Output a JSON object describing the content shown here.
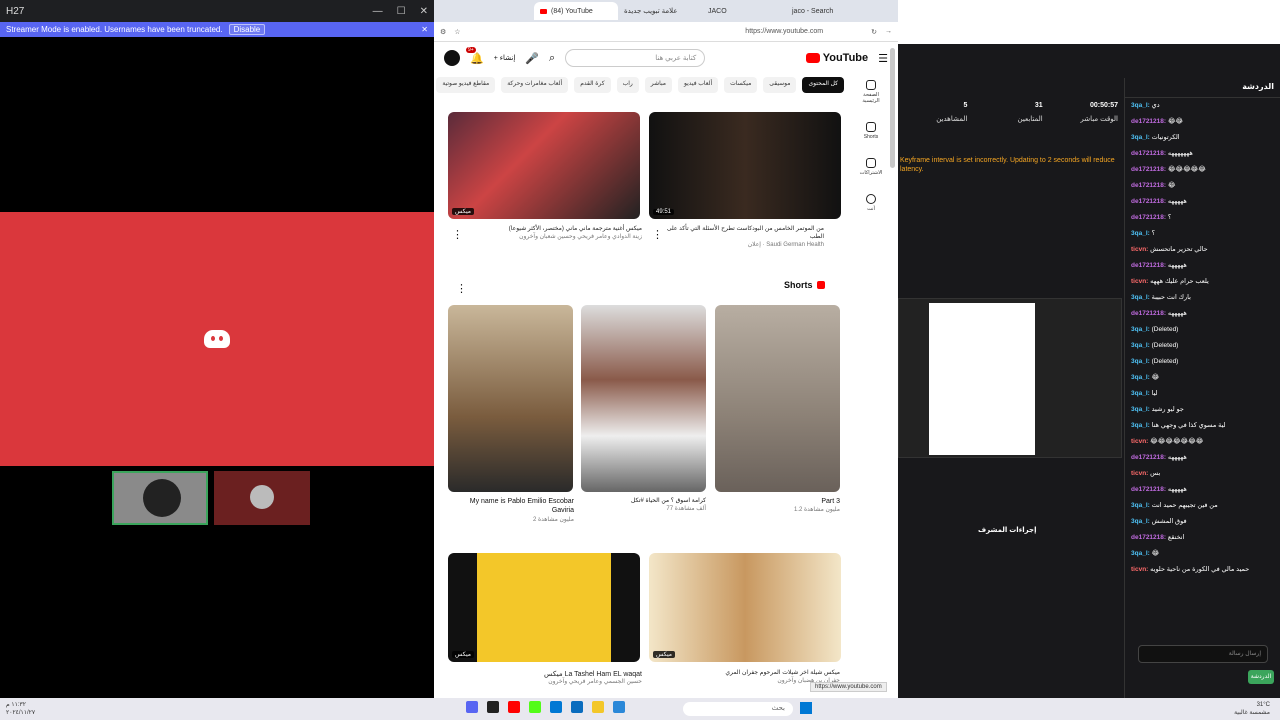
{
  "discord": {
    "title": "H27",
    "streamer_banner": "Streamer Mode is enabled. Usernames have been truncated.",
    "disable_label": "Disable"
  },
  "browser": {
    "tabs": [
      {
        "label": "(84) YouTube"
      },
      {
        "label": "علامة تبويب جديدة"
      },
      {
        "label": "JACO"
      },
      {
        "label": "jaco - Search"
      }
    ],
    "url": "https://www.youtube.com",
    "status_url": "https://www.youtube.com"
  },
  "youtube": {
    "logo": "YouTube",
    "search_placeholder": "كتابة عربي هنا",
    "notification_count": "9+",
    "create_label": "إنشاء",
    "chips": [
      "كل المحتوى",
      "موسيقى",
      "ميكسات",
      "ألعاب فيديو",
      "مباشر",
      "راب",
      "كرة القدم",
      "ألعاب مغامرات وحركة",
      "مقاطع فيديو صوتية"
    ],
    "sidebar": [
      {
        "label": "الصفحة الرئيسية"
      },
      {
        "label": "Shorts"
      },
      {
        "label": "الاشتراكات"
      },
      {
        "label": "أنت"
      }
    ],
    "videos": [
      {
        "title": "ميكس أغنية مترجمة ماني ماني (مختصر، الأكثر شيوعا)",
        "meta": "زينة الدوادي وعامر فريحي وحسين شعبان وآخرون",
        "duration": "ميكس"
      },
      {
        "title": "من الموتمر الخامس من البودكاست تطرح الأسئلة التي تأكد على الطب",
        "meta": "Saudi German Health · إعلان",
        "duration": "49:51"
      }
    ],
    "shorts_heading": "Shorts",
    "shorts": [
      {
        "title": "My name is Pablo Emilio Escobar Gaviria",
        "meta": "2 مليون مشاهدة"
      },
      {
        "title": "كرامة اسوق ؟ من الحياة #تكل",
        "meta": "77 ألف مشاهدة"
      },
      {
        "title": "Part 3",
        "meta": "1.2 مليون مشاهدة"
      }
    ],
    "videos2": [
      {
        "title": "La Tashel Ham EL waqat ميكس",
        "meta": "حسين الجسمي وعامر فريحي وآخرون",
        "duration": "ميكس"
      },
      {
        "title": "ميكس شيلة اخر شيلات المرحوم جفران المري",
        "meta": "جفران بن هضبان وآخرون",
        "duration": "ميكس"
      }
    ]
  },
  "obs": {
    "stats": [
      {
        "label": "الوقت مباشر",
        "value": "00:50:57"
      },
      {
        "label": "المتابعين",
        "value": "31"
      },
      {
        "label": "المشاهدين",
        "value": "5"
      }
    ],
    "warning": "Keyframe interval is set incorrectly. Updating to 2 seconds will reduce latency.",
    "docks": [
      "إجراءات المشرف"
    ],
    "chat_title": "الدردشة",
    "chat_input_placeholder": "إرسال رسالة",
    "chat_button": "الدردشة",
    "messages": [
      {
        "user": "3qa_l:",
        "text": "دي"
      },
      {
        "user": "de1721218:",
        "text": "😂😂"
      },
      {
        "user": "3qa_l:",
        "text": "الكرتونيات"
      },
      {
        "user": "de1721218:",
        "text": "هههههههه"
      },
      {
        "user": "de1721218:",
        "text": "😂😂😂😂😂"
      },
      {
        "user": "de1721218:",
        "text": "😂"
      },
      {
        "user": "de1721218:",
        "text": "هههههه"
      },
      {
        "user": "de1721218:",
        "text": "؟"
      },
      {
        "user": "3qa_l:",
        "text": "؟"
      },
      {
        "user": "ticvn:",
        "text": "حالي تحزير ماتحسش"
      },
      {
        "user": "de1721218:",
        "text": "هههههه"
      },
      {
        "user": "ticvn:",
        "text": "يلعب حرام عليك هههه"
      },
      {
        "user": "3qa_l:",
        "text": "بارك انت حبيبة"
      },
      {
        "user": "de1721218:",
        "text": "هههههه"
      },
      {
        "user": "3qa_l:",
        "text": "(Deleted)"
      },
      {
        "user": "3qa_l:",
        "text": "(Deleted)"
      },
      {
        "user": "3qa_l:",
        "text": "(Deleted)"
      },
      {
        "user": "3qa_l:",
        "text": "😂"
      },
      {
        "user": "3qa_l:",
        "text": "ليا"
      },
      {
        "user": "3qa_l:",
        "text": "جو ليو رشيد"
      },
      {
        "user": "3qa_l:",
        "text": "لية مسوي كذا في وجهي هنا"
      },
      {
        "user": "ticvn:",
        "text": "😂😂😂😂😂😂😂"
      },
      {
        "user": "de1721218:",
        "text": "هههههه"
      },
      {
        "user": "ticvn:",
        "text": "بس"
      },
      {
        "user": "de1721218:",
        "text": "هههههه"
      },
      {
        "user": "3qa_l:",
        "text": "من فين تجيبهم حميد انت"
      },
      {
        "user": "3qa_l:",
        "text": "فوق المشش"
      },
      {
        "user": "de1721218:",
        "text": "انخنقع"
      },
      {
        "user": "3qa_l:",
        "text": "😂"
      },
      {
        "user": "ticvn:",
        "text": "حميد مالي في الكورة من ناحية حلويه"
      }
    ]
  },
  "taskbar": {
    "search": "بحث",
    "time": "١١:٣٢ م",
    "date": "٢٠٢٤/١١/٢٧",
    "weather": "31°C",
    "weather_desc": "مشمسة غالبية"
  }
}
